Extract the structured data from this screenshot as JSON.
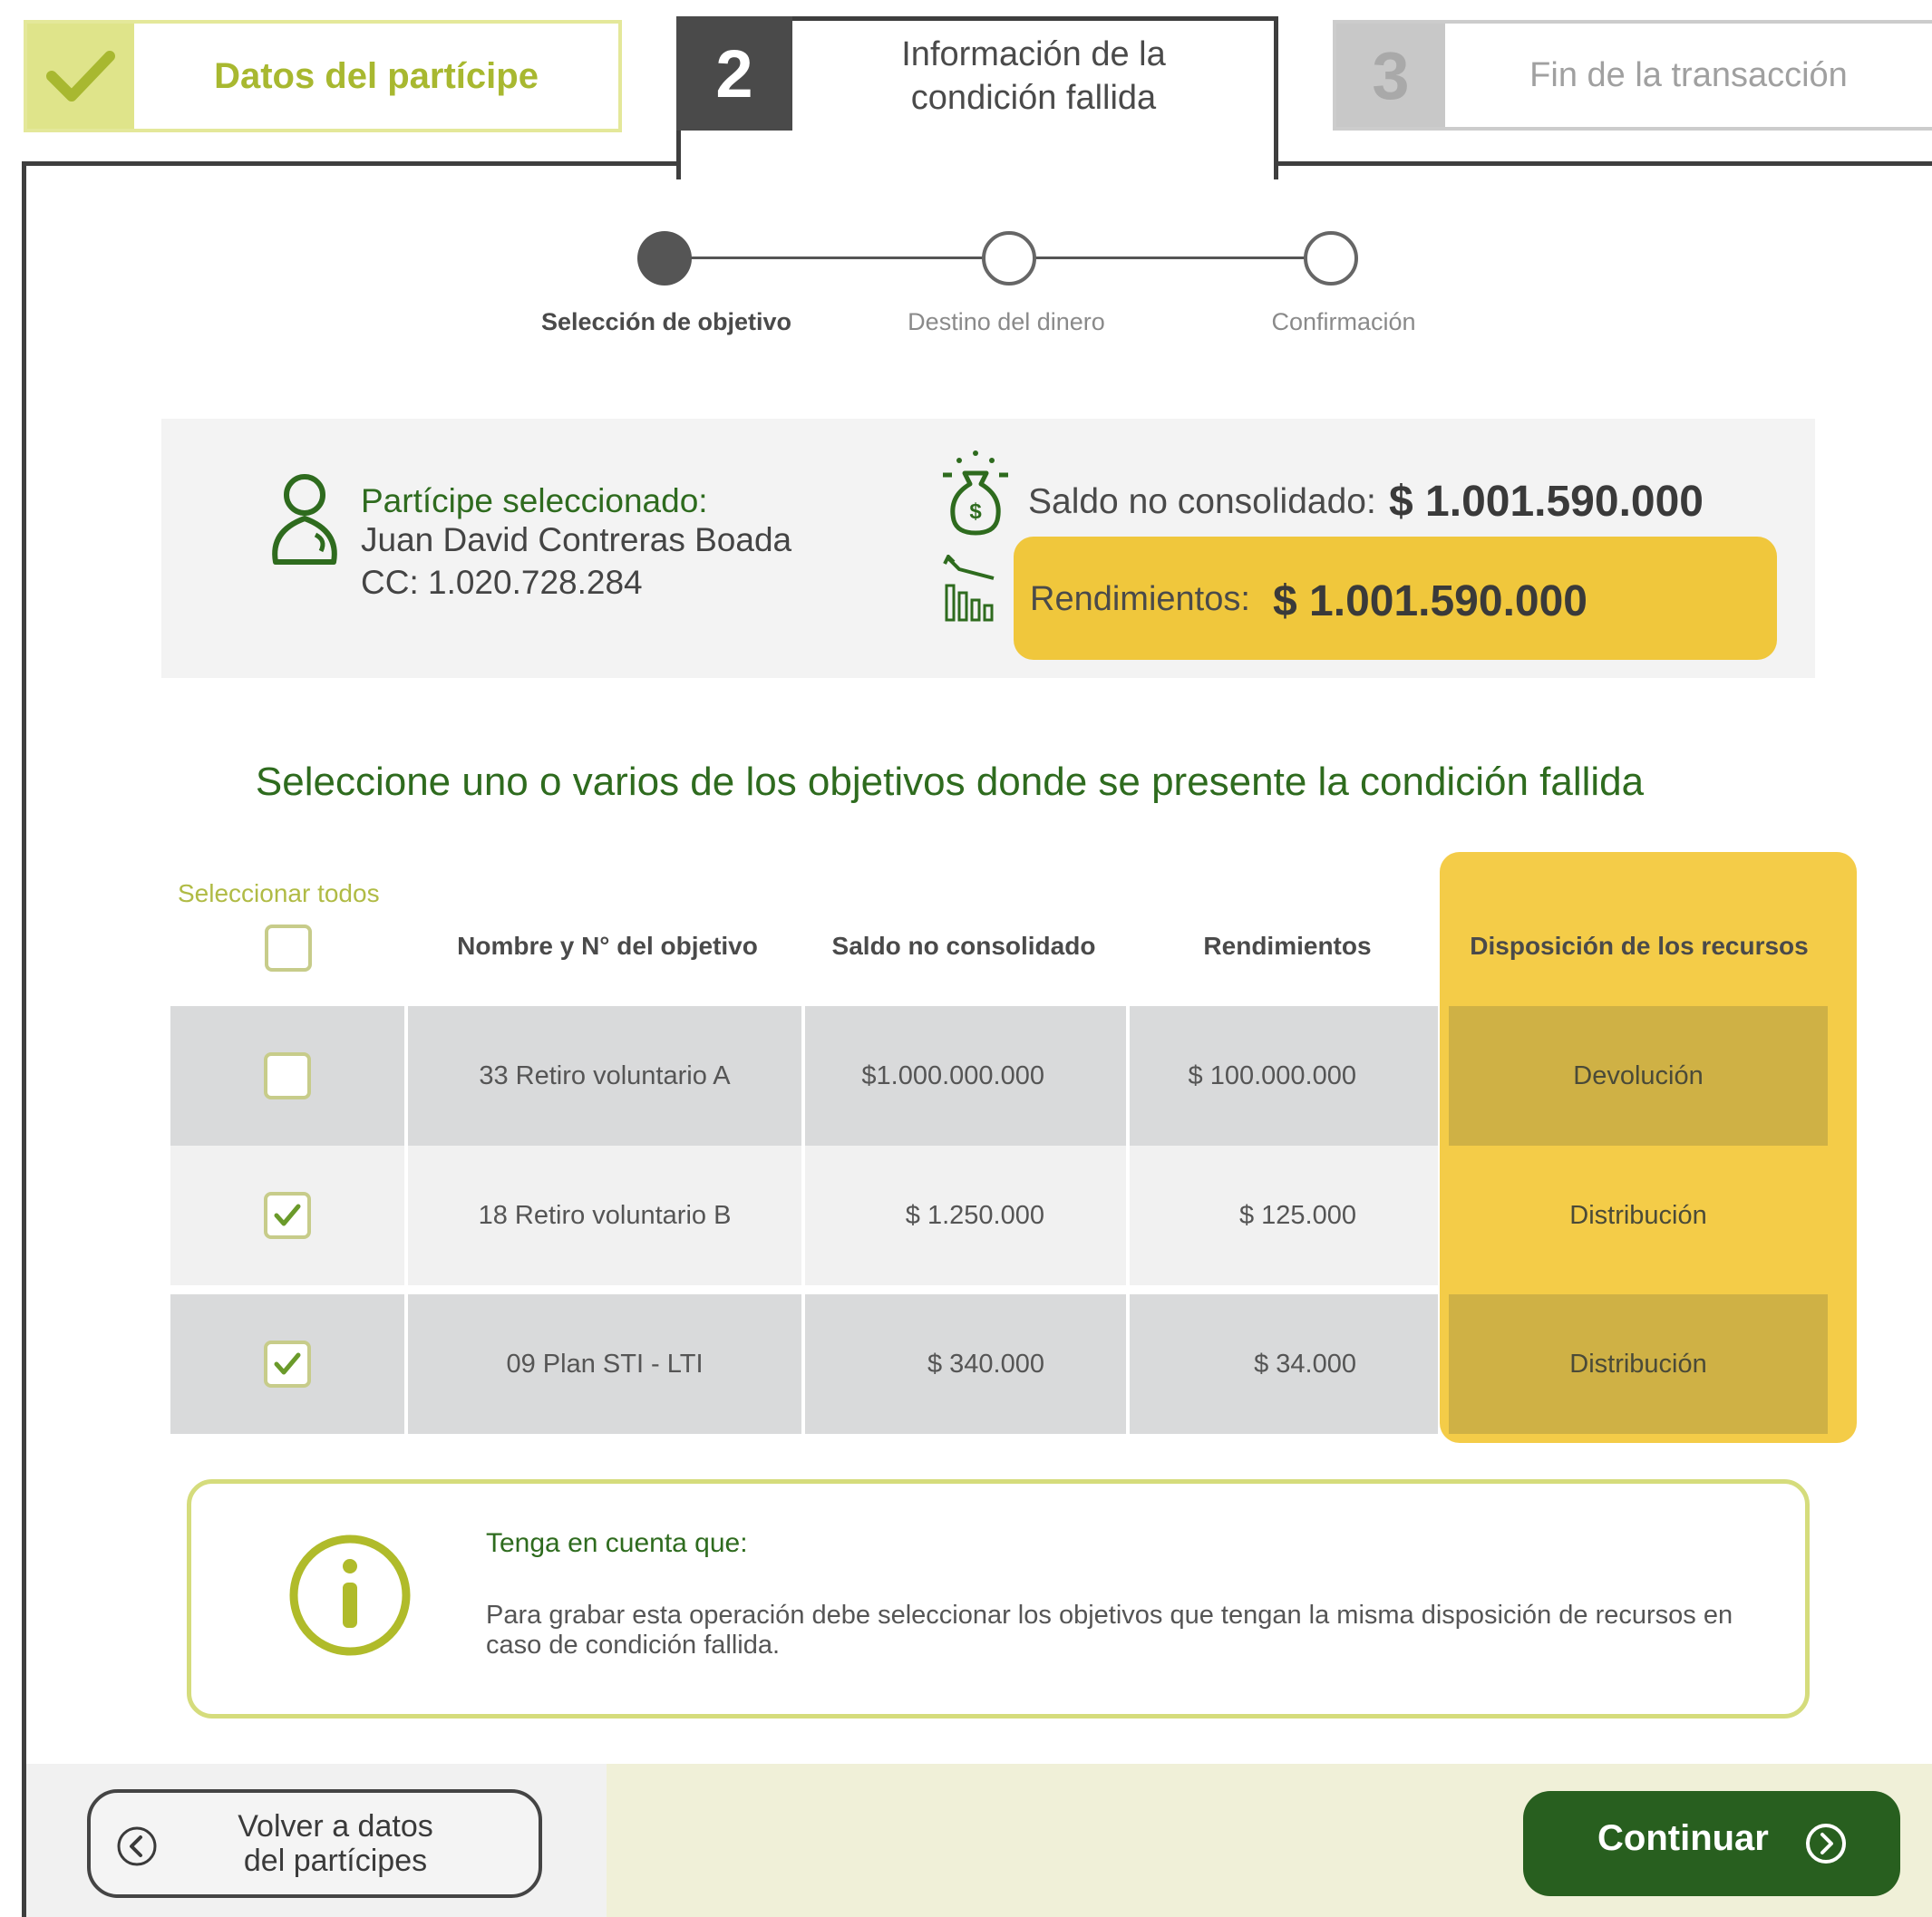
{
  "steps": [
    {
      "label": "Datos del partícipe",
      "status": "completed"
    },
    {
      "number": "2",
      "label_line1": "Información de la",
      "label_line2": "condición fallida",
      "status": "current"
    },
    {
      "number": "3",
      "label": "Fin de la transacción",
      "status": "pending"
    }
  ],
  "substeps": [
    "Selección de objetivo",
    "Destino del dinero",
    "Confirmación"
  ],
  "participant": {
    "title": "Partícipe seleccionado:",
    "name": "Juan David Contreras Boada",
    "id": "CC: 1.020.728.284"
  },
  "balances": {
    "saldo_label": "Saldo no consolidado:",
    "saldo_value": "$ 1.001.590.000",
    "rend_label": "Rendimientos:",
    "rend_value": "$ 1.001.590.000"
  },
  "heading": "Seleccione uno o varios de los objetivos donde se presente la condición fallida",
  "table": {
    "select_all_label": "Seleccionar todos",
    "select_all_checked": false,
    "headers": [
      "Nombre y N° del objetivo",
      "Saldo no consolidado",
      "Rendimientos",
      "Disposición de los recursos"
    ],
    "rows": [
      {
        "checked": false,
        "name": "33 Retiro voluntario A",
        "saldo": "$1.000.000.000",
        "rendimientos": "$ 100.000.000",
        "disposicion": "Devolución"
      },
      {
        "checked": true,
        "name": "18 Retiro voluntario B",
        "saldo": "$ 1.250.000",
        "rendimientos": "$ 125.000",
        "disposicion": "Distribución"
      },
      {
        "checked": true,
        "name": "09 Plan STI - LTI",
        "saldo": "$ 340.000",
        "rendimientos": "$ 34.000",
        "disposicion": "Distribución"
      }
    ]
  },
  "note": {
    "title": "Tenga en cuenta que:",
    "text": "Para grabar esta operación debe seleccionar los objetivos que tengan la misma disposición de recursos en caso de condición fallida."
  },
  "footer": {
    "back_label_line1": "Volver a datos",
    "back_label_line2": "del partícipes",
    "continue_label": "Continuar"
  },
  "colors": {
    "primary_green": "#285f1f",
    "light_green": "#a8b830",
    "highlight_yellow": "#f0c73c"
  }
}
